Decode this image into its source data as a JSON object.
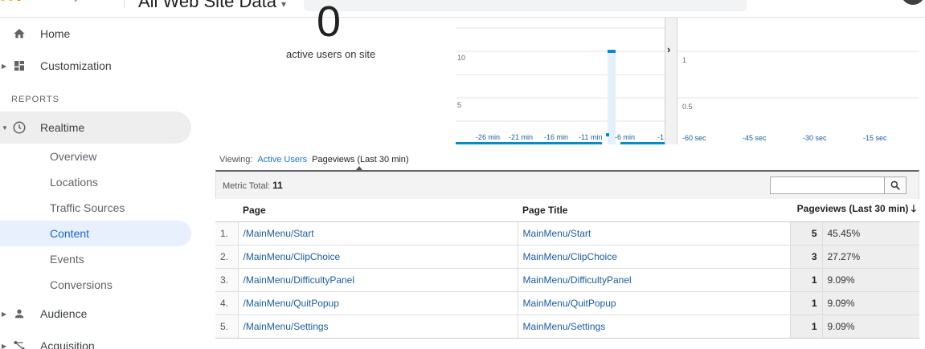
{
  "header": {
    "view_title": "All Web Site Data",
    "title_caret": "▾"
  },
  "sidebar": {
    "top_items": [
      {
        "label": "Home",
        "icon": "home-icon"
      },
      {
        "label": "Customization",
        "icon": "dashboard-icon"
      }
    ],
    "section_label": "REPORTS",
    "realtime": {
      "label": "Realtime",
      "icon": "clock-icon"
    },
    "realtime_items": [
      {
        "label": "Overview"
      },
      {
        "label": "Locations"
      },
      {
        "label": "Traffic Sources"
      },
      {
        "label": "Content"
      },
      {
        "label": "Events"
      },
      {
        "label": "Conversions"
      }
    ],
    "selected_item": "Content",
    "bottom_items": [
      {
        "label": "Audience",
        "icon": "person-icon"
      },
      {
        "label": "Acquisition",
        "icon": "acquisition-icon"
      }
    ]
  },
  "summary": {
    "active_users": "0",
    "active_users_label": "active users on site"
  },
  "chart_data": [
    {
      "type": "bar",
      "x_tick_labels": [
        "-26 min",
        "-21 min",
        "-16 min",
        "-11 min",
        "-6 min",
        "-1"
      ],
      "y_tick_labels": [
        "10",
        "5"
      ],
      "values_note_series": [
        {
          "x": "-8 min",
          "value": 11
        }
      ],
      "color": "#058dc7"
    },
    {
      "type": "bar",
      "x_tick_labels": [
        "-60 sec",
        "-45 sec",
        "-30 sec",
        "-15 sec"
      ],
      "y_tick_labels": [
        "1",
        "0.5"
      ],
      "color": "#058dc7"
    }
  ],
  "viewing": {
    "label": "Viewing:",
    "options": [
      "Active Users",
      "Pageviews (Last 30 min)"
    ],
    "current": "Pageviews (Last 30 min)"
  },
  "metric": {
    "label": "Metric Total:",
    "value": "11",
    "search_placeholder": ""
  },
  "table": {
    "headers": {
      "page": "Page",
      "title": "Page Title",
      "pageviews": "Pageviews (Last 30 min)"
    },
    "sort_indicator": "🡓",
    "rows": [
      {
        "index": "1.",
        "page": "/MainMenu/Start",
        "title": "MainMenu/Start",
        "pageviews": "5",
        "percent": "45.45%"
      },
      {
        "index": "2.",
        "page": "/MainMenu/ClipChoice",
        "title": "MainMenu/ClipChoice",
        "pageviews": "3",
        "percent": "27.27%"
      },
      {
        "index": "3.",
        "page": "/MainMenu/DifficultyPanel",
        "title": "MainMenu/DifficultyPanel",
        "pageviews": "1",
        "percent": "9.09%"
      },
      {
        "index": "4.",
        "page": "/MainMenu/QuitPopup",
        "title": "MainMenu/QuitPopup",
        "pageviews": "1",
        "percent": "9.09%"
      },
      {
        "index": "5.",
        "page": "/MainMenu/Settings",
        "title": "MainMenu/Settings",
        "pageviews": "1",
        "percent": "9.09%"
      }
    ]
  },
  "colors": {
    "accent": "#1967d2",
    "link": "#1a5ea0",
    "bar": "#058dc7",
    "selected_bg": "#e8f0fe"
  }
}
